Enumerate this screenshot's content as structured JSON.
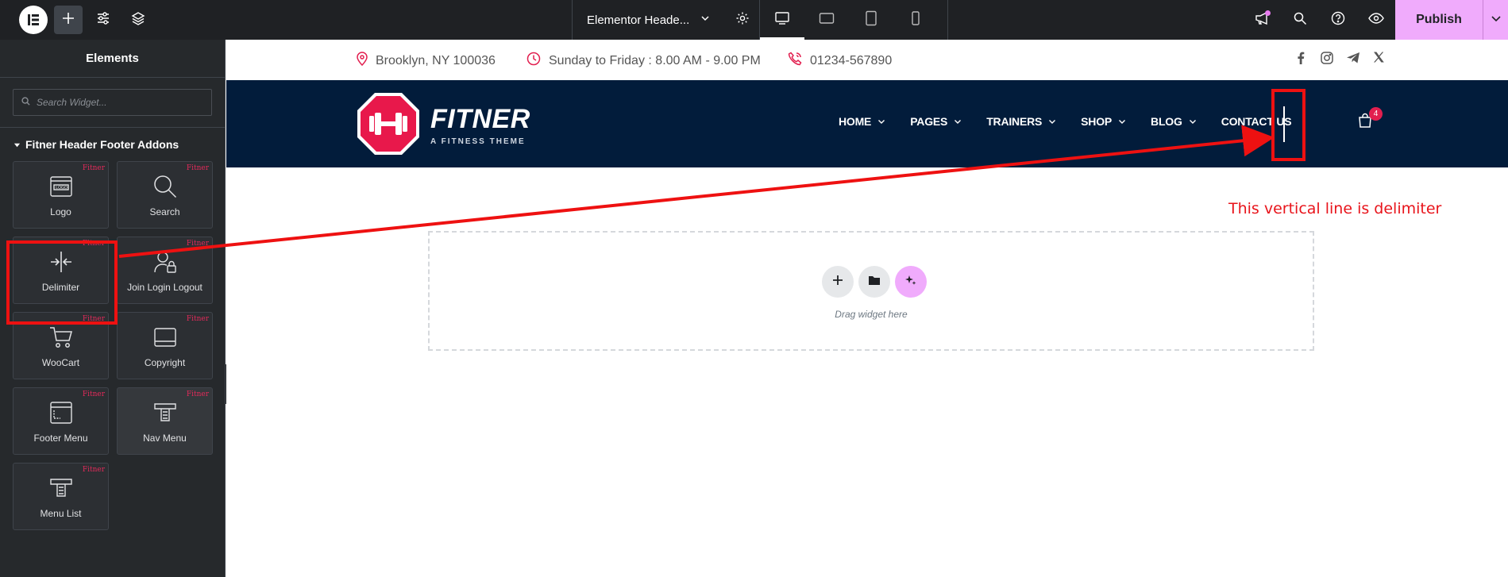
{
  "topbar": {
    "doc_title": "Elementor Heade...",
    "publish_label": "Publish"
  },
  "sidebar": {
    "title": "Elements",
    "search_placeholder": "Search Widget...",
    "category": "Fitner Header Footer Addons",
    "badge": "Fitner",
    "widgets": [
      {
        "label": "Logo",
        "icon": "logo-icon"
      },
      {
        "label": "Search",
        "icon": "search-icon"
      },
      {
        "label": "Delimiter",
        "icon": "delimiter-icon"
      },
      {
        "label": "Join Login Logout",
        "icon": "user-lock-icon"
      },
      {
        "label": "WooCart",
        "icon": "cart-icon"
      },
      {
        "label": "Copyright",
        "icon": "copyright-icon"
      },
      {
        "label": "Footer Menu",
        "icon": "footer-menu-icon"
      },
      {
        "label": "Nav Menu",
        "icon": "nav-menu-icon"
      },
      {
        "label": "Menu List",
        "icon": "menu-list-icon"
      }
    ]
  },
  "preview": {
    "info": {
      "location": "Brooklyn, NY 100036",
      "hours": "Sunday to Friday : 8.00 AM - 9.00 PM",
      "phone": "01234-567890"
    },
    "brand": {
      "name": "FITNER",
      "tagline": "A FITNESS THEME"
    },
    "menu": [
      "HOME",
      "PAGES",
      "TRAINERS",
      "SHOP",
      "BLOG",
      "CONTACT US"
    ],
    "cart_count": "4",
    "dropzone_text": "Drag widget here"
  },
  "annotation": {
    "text": "This vertical line is delimiter",
    "color": "#ee1111"
  },
  "colors": {
    "accent_pink": "#f0abfc",
    "brand_red": "#e21f4f",
    "navy": "#021c3b"
  }
}
